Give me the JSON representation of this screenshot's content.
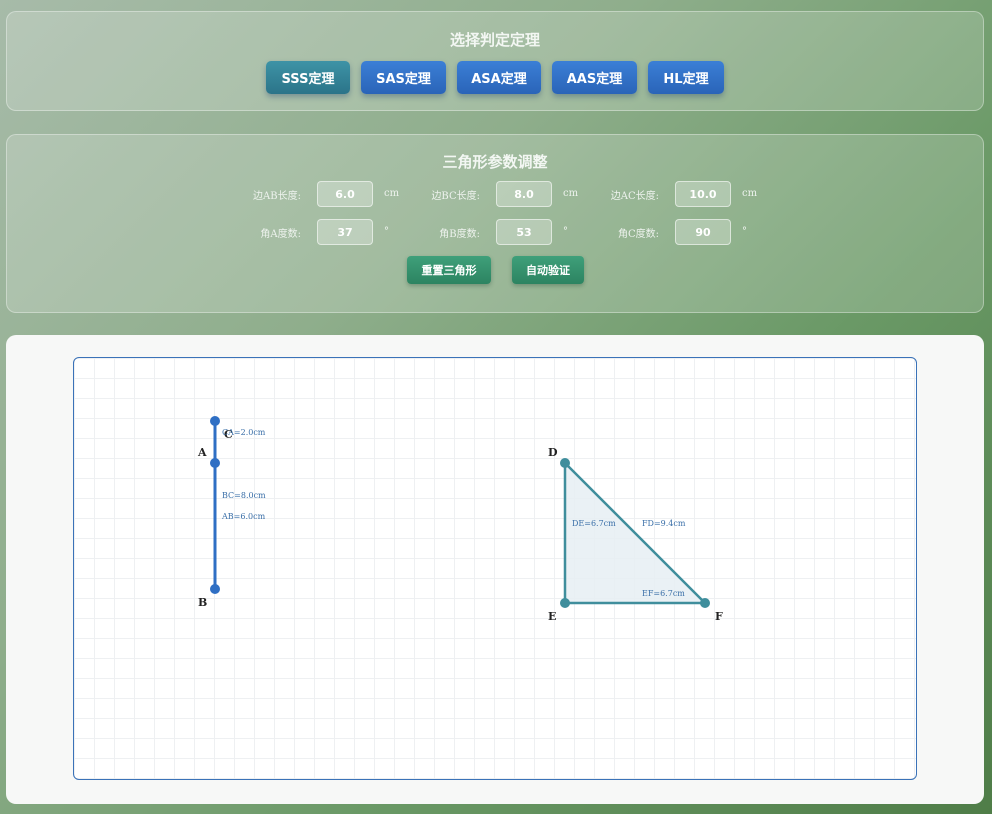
{
  "theorem_panel": {
    "title": "选择判定定理",
    "buttons": [
      {
        "id": "sss",
        "label": "SSS定理",
        "active": true
      },
      {
        "id": "sas",
        "label": "SAS定理",
        "active": false
      },
      {
        "id": "asa",
        "label": "ASA定理",
        "active": false
      },
      {
        "id": "aas",
        "label": "AAS定理",
        "active": false
      },
      {
        "id": "hl",
        "label": "HL定理",
        "active": false
      }
    ]
  },
  "params_panel": {
    "title": "三角形参数调整",
    "sides": [
      {
        "label": "边AB长度:",
        "value": "6.0",
        "unit": "cm"
      },
      {
        "label": "边BC长度:",
        "value": "8.0",
        "unit": "cm"
      },
      {
        "label": "边AC长度:",
        "value": "10.0",
        "unit": "cm"
      }
    ],
    "angles": [
      {
        "label": "角A度数:",
        "value": "37",
        "unit": "°"
      },
      {
        "label": "角B度数:",
        "value": "53",
        "unit": "°"
      },
      {
        "label": "角C度数:",
        "value": "90",
        "unit": "°"
      }
    ],
    "reset_label": "重置三角形",
    "verify_label": "自动验证"
  },
  "canvas": {
    "triangle_abc": {
      "points": {
        "A": "A",
        "B": "B",
        "C": "C"
      },
      "labels": {
        "CA": "CA=2.0cm",
        "BC": "BC=8.0cm",
        "AB": "AB=6.0cm"
      }
    },
    "triangle_def": {
      "points": {
        "D": "D",
        "E": "E",
        "F": "F"
      },
      "labels": {
        "DE": "DE=6.7cm",
        "FD": "FD=9.4cm",
        "EF": "EF=6.7cm"
      }
    },
    "colors": {
      "abc_stroke": "#2f6fc4",
      "def_stroke": "#3f8e9c",
      "def_fill": "#e6eef3"
    }
  }
}
